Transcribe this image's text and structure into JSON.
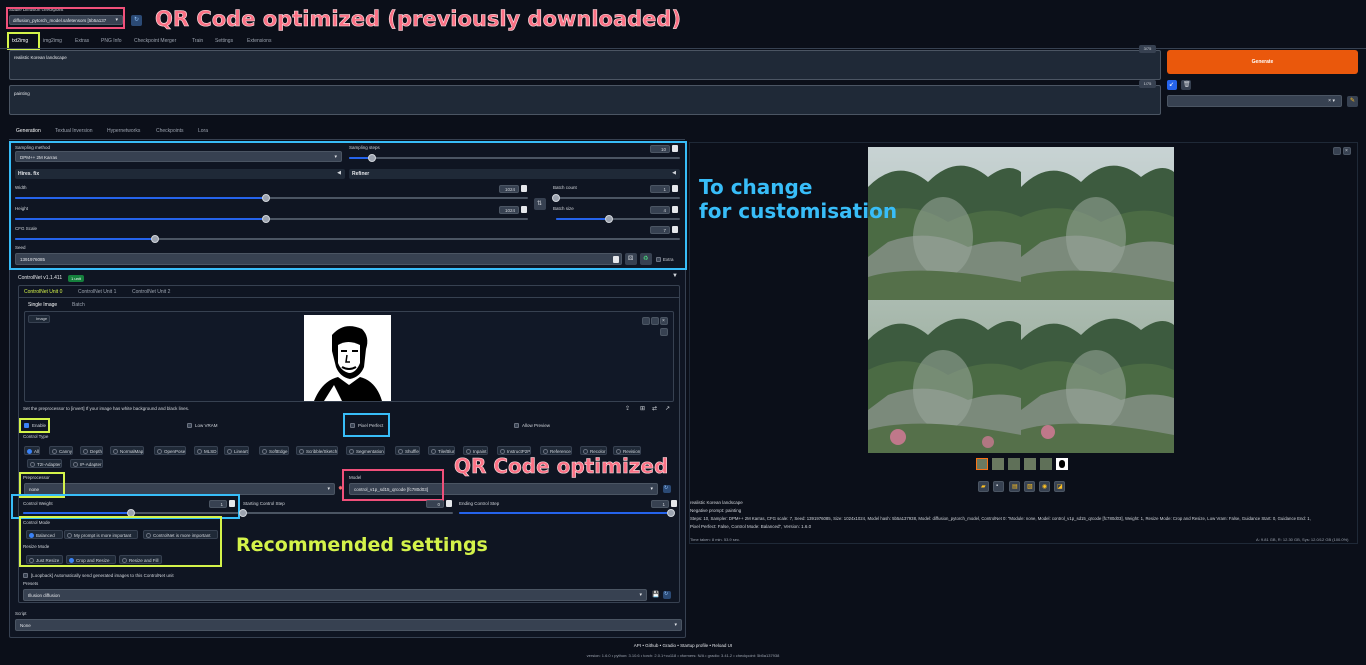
{
  "checkpoint": {
    "label": "Stable Diffusion checkpoint",
    "value": "diffusion_pytorch_model.safetensors [5b5a137"
  },
  "main_tabs": [
    "txt2img",
    "img2img",
    "Extras",
    "PNG Info",
    "Checkpoint Merger",
    "Train",
    "Settings",
    "Extensions"
  ],
  "prompt": {
    "text": "realistic Korean landscape",
    "count": "3/75"
  },
  "negative": {
    "text": "painting",
    "count": "1/75"
  },
  "generate_label": "Generate",
  "sub_tabs": [
    "Generation",
    "Textual Inversion",
    "Hypernetworks",
    "Checkpoints",
    "Lora"
  ],
  "sampling": {
    "method_label": "Sampling method",
    "method": "DPM++ 2M Karras",
    "steps_label": "Sampling steps",
    "steps": "10",
    "steps_frac": 0.07
  },
  "hires_label": "Hires. fix",
  "refiner_label": "Refiner",
  "width": {
    "label": "Width",
    "value": "1024",
    "frac": 0.49
  },
  "height": {
    "label": "Height",
    "value": "1024",
    "frac": 0.49
  },
  "batch_count": {
    "label": "Batch count",
    "value": "1",
    "frac": 0.0
  },
  "batch_size": {
    "label": "Batch size",
    "value": "4",
    "frac": 0.43
  },
  "cfg": {
    "label": "CFG Scale",
    "value": "7",
    "frac": 0.21
  },
  "seed": {
    "label": "Seed",
    "value": "1391976085",
    "extra": "Extra"
  },
  "controlnet": {
    "title": "ControlNet v1.1.411",
    "badge": "1 unit",
    "unit_tabs": [
      "ControlNet Unit 0",
      "ControlNet Unit 1",
      "ControlNet Unit 2"
    ],
    "image_tabs": [
      "Single Image",
      "Batch"
    ],
    "image_label": "Image",
    "hint": "Set the preprocessor to [invert] If your image has white background and black lines.",
    "enable": "Enable",
    "low_vram": "Low VRAM",
    "pixel_perfect": "Pixel Perfect",
    "allow_preview": "Allow Preview",
    "control_type_label": "Control Type",
    "control_types": [
      "All",
      "Canny",
      "Depth",
      "NormalMap",
      "OpenPose",
      "MLSD",
      "Lineart",
      "SoftEdge",
      "Scribble/Sketch",
      "Segmentation",
      "Shuffle",
      "Tile/Blur",
      "Inpaint",
      "InstructP2P",
      "Reference",
      "Recolor",
      "Revision",
      "T2I-Adapter",
      "IP-Adapter"
    ],
    "preprocessor_label": "Preprocessor",
    "preprocessor": "none",
    "model_label": "Model",
    "model": "control_v1p_sd15_qrcode [fc780d03]",
    "weight_label": "Control Weight",
    "weight": "1",
    "start_label": "Starting Control Step",
    "start": "0",
    "end_label": "Ending Control Step",
    "end": "1",
    "mode_label": "Control Mode",
    "modes": [
      "Balanced",
      "My prompt is more important",
      "ControlNet is more important"
    ],
    "resize_label": "Resize Mode",
    "resizes": [
      "Just Resize",
      "Crop and Resize",
      "Resize and Fill"
    ],
    "loopback": "[Loopback] Automatically send generated images to this ControlNet unit",
    "presets_label": "Presets",
    "preset": "Illusion diffusion"
  },
  "script": {
    "label": "Script",
    "value": "None"
  },
  "output": {
    "prompt": "realistic Korean landscape",
    "negative": "Negative prompt: painting",
    "params": "Steps: 10, Sampler: DPM++ 2M Karras, CFG scale: 7, Seed: 1391976085, Size: 1024x1024, Model hash: 5b5a137938, Model: diffusion_pytorch_model, ControlNet 0: \"Module: none, Model: control_v1p_sd15_qrcode [fc780d03], Weight: 1, Resize Mode: Crop and Resize, Low Vram: False, Guidance Start: 0, Guidance End: 1,",
    "params2": "Pixel Perfect: False, Control Mode: Balanced\", Version: 1.6.0",
    "time": "Time taken: 8 min. 53.9 sec.",
    "vram": "A: 9.81 GB, R: 12.30 GB, Sys: 12.0/12 GB (100.0%)"
  },
  "footer": {
    "links": [
      "API",
      "Github",
      "Gradio",
      "Startup profile",
      "Reload UI"
    ],
    "versions": "version: 1.6.0  •  python: 3.10.6  •  torch: 2.0.1+cu118  •  xformers: N/A  •  gradio: 3.41.2  •  checkpoint: 5b5a137938"
  },
  "annotations": {
    "qr_top": "QR Code optimized (previously downloaded)",
    "change": "To change",
    "custom": "for customisation",
    "qr_model": "QR Code optimized",
    "recommended": "Recommended settings"
  },
  "colors": {
    "pink": "#f0507a",
    "blue": "#38bdf8",
    "green": "#d4f34a",
    "generate": "#ea580c"
  }
}
